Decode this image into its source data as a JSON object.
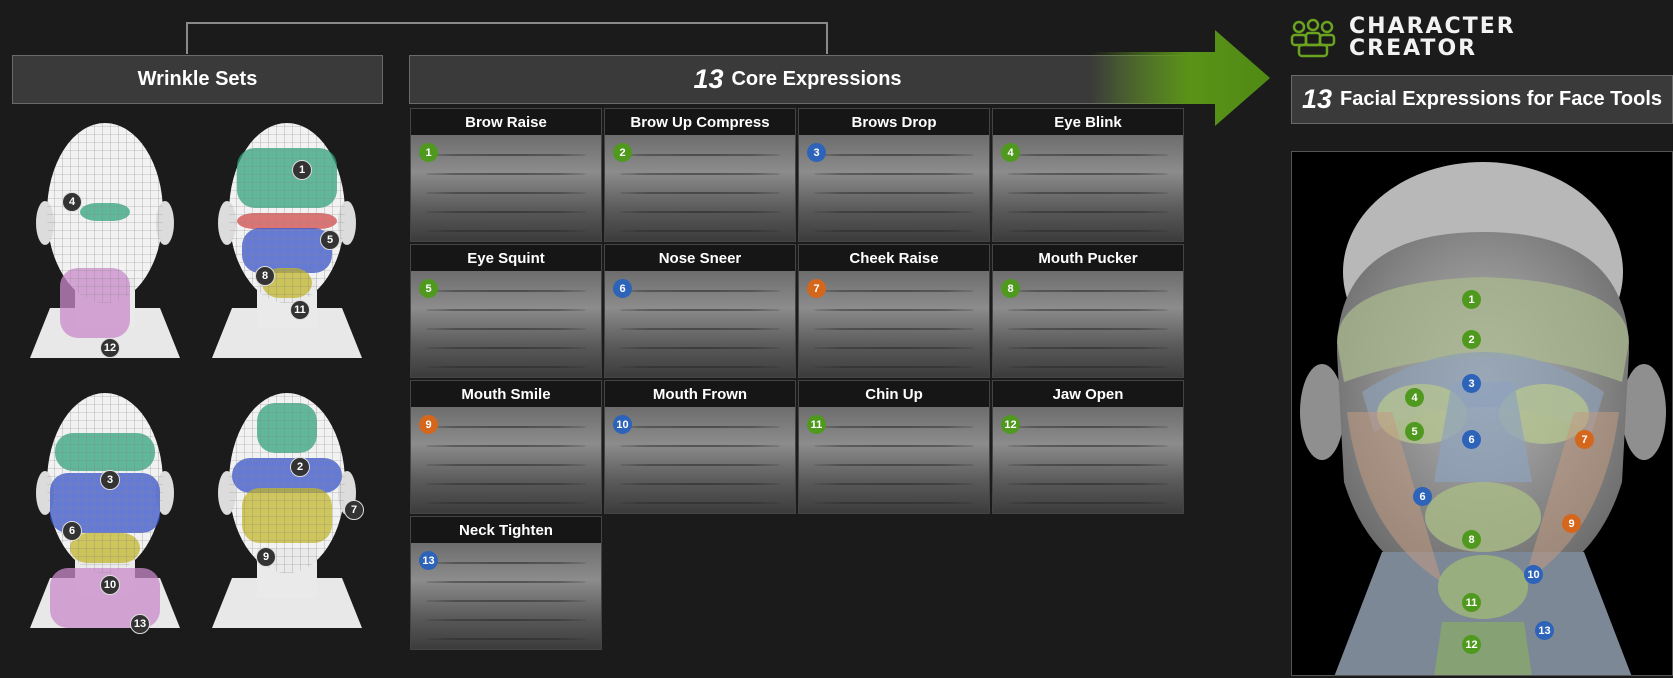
{
  "logo": {
    "line1": "CHARACTER",
    "line2": "CREATOR"
  },
  "wrinkle_sets": {
    "title": "Wrinkle Sets"
  },
  "core": {
    "num": "13",
    "label": "Core Expressions"
  },
  "facial": {
    "num": "13",
    "label": "Facial Expressions for Face Tools"
  },
  "heads": [
    {
      "badges": [
        "4",
        "12"
      ]
    },
    {
      "badges": [
        "1",
        "5",
        "8",
        "11"
      ]
    },
    {
      "badges": [
        "3",
        "6",
        "10",
        "13"
      ]
    },
    {
      "badges": [
        "2",
        "7",
        "9"
      ]
    }
  ],
  "expressions": [
    {
      "name": "Brow Raise",
      "num": "1",
      "color": "green"
    },
    {
      "name": "Brow Up Compress",
      "num": "2",
      "color": "green"
    },
    {
      "name": "Brows Drop",
      "num": "3",
      "color": "blue"
    },
    {
      "name": "Eye Blink",
      "num": "4",
      "color": "green"
    },
    {
      "name": "Eye Squint",
      "num": "5",
      "color": "green"
    },
    {
      "name": "Nose Sneer",
      "num": "6",
      "color": "blue"
    },
    {
      "name": "Cheek Raise",
      "num": "7",
      "color": "orange"
    },
    {
      "name": "Mouth Pucker",
      "num": "8",
      "color": "green"
    },
    {
      "name": "Mouth Smile",
      "num": "9",
      "color": "orange"
    },
    {
      "name": "Mouth Frown",
      "num": "10",
      "color": "blue"
    },
    {
      "name": "Chin Up",
      "num": "11",
      "color": "green"
    },
    {
      "name": "Jaw Open",
      "num": "12",
      "color": "green"
    },
    {
      "name": "Neck Tighten",
      "num": "13",
      "color": "blue"
    }
  ],
  "face_map_badges": [
    {
      "num": "1",
      "color": "green"
    },
    {
      "num": "2",
      "color": "green"
    },
    {
      "num": "3",
      "color": "blue"
    },
    {
      "num": "4",
      "color": "green"
    },
    {
      "num": "5",
      "color": "green"
    },
    {
      "num": "6",
      "color": "blue"
    },
    {
      "num": "7",
      "color": "orange"
    },
    {
      "num": "6",
      "color": "blue"
    },
    {
      "num": "9",
      "color": "orange"
    },
    {
      "num": "8",
      "color": "green"
    },
    {
      "num": "10",
      "color": "blue"
    },
    {
      "num": "11",
      "color": "green"
    },
    {
      "num": "12",
      "color": "green"
    },
    {
      "num": "13",
      "color": "blue"
    }
  ],
  "colors": {
    "green": "#4f9a1e",
    "blue": "#2d63b8",
    "orange": "#d4671c",
    "accent": "#6aa31f"
  }
}
